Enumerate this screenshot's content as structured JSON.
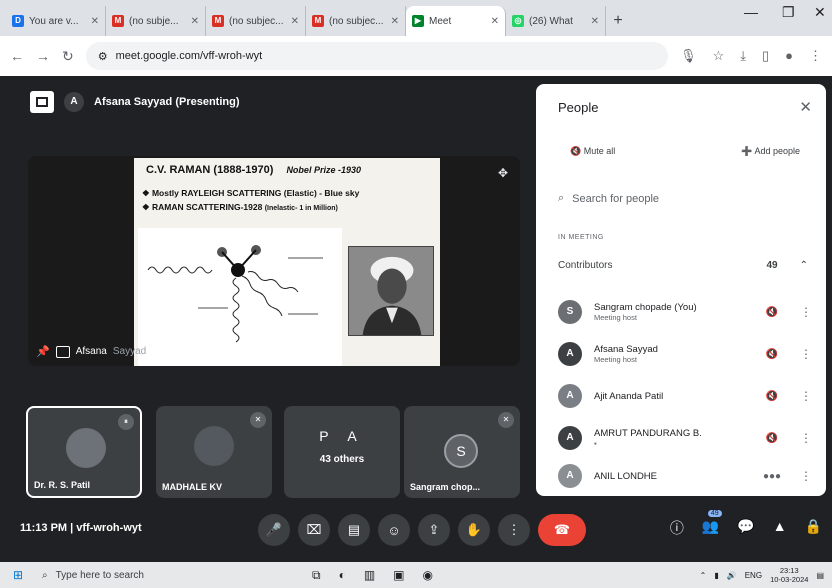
{
  "browser": {
    "tabs": [
      {
        "label": "You are v...",
        "icon": "docs-icon",
        "color": "#1a73e8"
      },
      {
        "label": "(no subje...",
        "icon": "gmail-icon",
        "color": "#d93025"
      },
      {
        "label": "(no subjec...",
        "icon": "gmail-icon",
        "color": "#d93025"
      },
      {
        "label": "(no subjec...",
        "icon": "gmail-icon",
        "color": "#d93025"
      },
      {
        "label": "Meet",
        "icon": "meet-icon",
        "color": "#00832d"
      },
      {
        "label": "(26) What",
        "icon": "whatsapp-icon",
        "color": "#25d366"
      }
    ],
    "url": "meet.google.com/vff-wroh-wyt"
  },
  "meet": {
    "presenter_label": "Afsana Sayyad (Presenting)",
    "presenter_initial": "A",
    "share_footer_name": "Afsana",
    "share_footer_suffix": "Sayyad",
    "slide": {
      "title": "C.V. RAMAN  (1888-1970)",
      "nobel": "Nobel Prize -1930",
      "bullet1": "❖ Mostly  RAYLEIGH SCATTERING (Elastic) - Blue sky",
      "bullet2": "❖ RAMAN SCATTERING-1928",
      "bullet2_small": "(Inelastic- 1 in  Million)"
    },
    "tiles": [
      {
        "name": "Dr. R. S. Patil"
      },
      {
        "name": "MADHALE KV"
      },
      {
        "letters": "P A",
        "others": "43 others"
      },
      {
        "initial": "S",
        "name": "Sangram chop..."
      }
    ],
    "meeting_info": "11:13 PM  |  vff-wroh-wyt",
    "participant_badge": "49"
  },
  "people": {
    "title": "People",
    "mute_all": "Mute all",
    "add_people": "Add people",
    "search_placeholder": "Search for people",
    "in_meeting": "IN MEETING",
    "contributors": "Contributors",
    "count": "49",
    "rows": [
      {
        "name": "Sangram chopade (You)",
        "role": "Meeting host",
        "initial": "S",
        "color": "#6b6f74"
      },
      {
        "name": "Afsana Sayyad",
        "role": "Meeting host",
        "initial": "A",
        "color": "#3c4043"
      },
      {
        "name": "Ajit Ananda Patil",
        "role": "",
        "initial": "A",
        "color": "#7a7f85"
      },
      {
        "name": "AMRUT PANDURANG B.",
        "role": "",
        "initial": "A",
        "color": "#3c4043"
      },
      {
        "name": "ANIL LONDHE",
        "role": "",
        "initial": "A",
        "color": "#8a8f94"
      }
    ]
  },
  "taskbar": {
    "search_placeholder": "Type here to search",
    "lang": "ENG",
    "time": "23:13",
    "date": "10-03-2024"
  }
}
